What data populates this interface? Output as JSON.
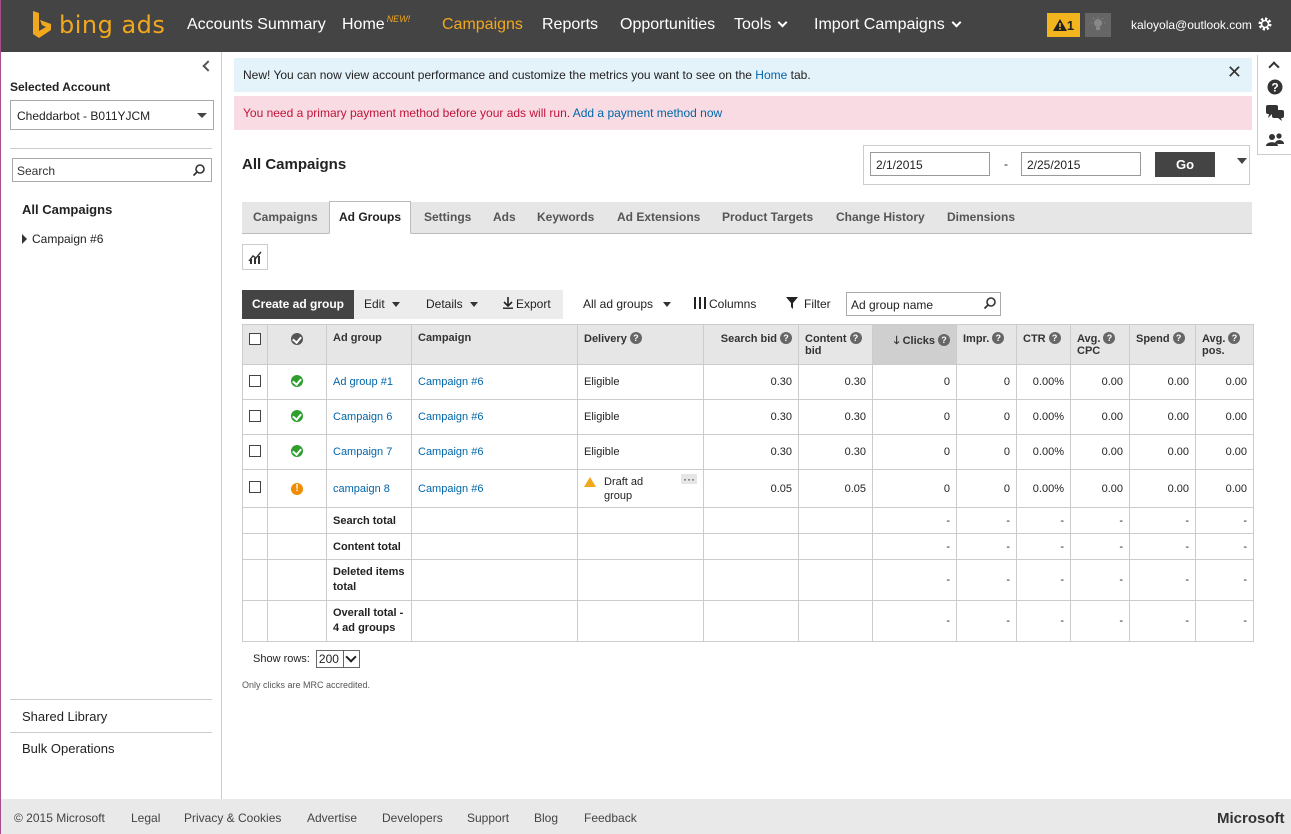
{
  "brand": {
    "name": "bing ads"
  },
  "topnav": {
    "items": [
      {
        "label": "Accounts Summary"
      },
      {
        "label": "Home",
        "badge": "NEW!"
      },
      {
        "label": "Campaigns"
      },
      {
        "label": "Reports"
      },
      {
        "label": "Opportunities"
      },
      {
        "label": "Tools"
      },
      {
        "label": "Import Campaigns"
      }
    ],
    "alert_count": "1",
    "user": "kaloyola@outlook.com"
  },
  "sidebar": {
    "selected_account_label": "Selected Account",
    "account": "Cheddarbot - B011YJCM",
    "search_placeholder": "Search",
    "all_campaigns": "All Campaigns",
    "campaign_node": "Campaign #6",
    "shared_library": "Shared Library",
    "bulk_operations": "Bulk Operations"
  },
  "banners": {
    "info_prefix": "New! You can now view account performance and customize the metrics you want to see on the ",
    "info_link": "Home",
    "info_suffix": " tab.",
    "error_text": "You need a primary payment method before your ads will run. ",
    "error_link": "Add a payment method now"
  },
  "main": {
    "title": "All Campaigns",
    "date_from": "2/1/2015",
    "date_sep": "-",
    "date_to": "2/25/2015",
    "go": "Go",
    "tabs": [
      "Campaigns",
      "Ad Groups",
      "Settings",
      "Ads",
      "Keywords",
      "Ad Extensions",
      "Product Targets",
      "Change History",
      "Dimensions"
    ],
    "active_tab": "Ad Groups"
  },
  "toolbar": {
    "create": "Create ad group",
    "edit": "Edit",
    "details": "Details",
    "export": "Export",
    "filter_select": "All ad groups",
    "columns": "Columns",
    "filter": "Filter",
    "search_placeholder": "Ad group name"
  },
  "grid": {
    "headers": {
      "ad_group": "Ad group",
      "campaign": "Campaign",
      "delivery": "Delivery",
      "search_bid": "Search bid",
      "content_bid_1": "Content",
      "content_bid_2": "bid",
      "clicks": "Clicks",
      "impr": "Impr.",
      "ctr": "CTR",
      "avg_cpc_1": "Avg.",
      "avg_cpc_2": "CPC",
      "spend": "Spend",
      "avg_pos_1": "Avg.",
      "avg_pos_2": "pos."
    },
    "rows": [
      {
        "status": "ok",
        "ad_group": "Ad group #1",
        "campaign": "Campaign #6",
        "delivery": "Eligible",
        "search_bid": "0.30",
        "content_bid": "0.30",
        "clicks": "0",
        "impr": "0",
        "ctr": "0.00%",
        "avg_cpc": "0.00",
        "spend": "0.00",
        "avg_pos": "0.00"
      },
      {
        "status": "ok",
        "ad_group": "Campaign 6",
        "campaign": "Campaign #6",
        "delivery": "Eligible",
        "search_bid": "0.30",
        "content_bid": "0.30",
        "clicks": "0",
        "impr": "0",
        "ctr": "0.00%",
        "avg_cpc": "0.00",
        "spend": "0.00",
        "avg_pos": "0.00"
      },
      {
        "status": "ok",
        "ad_group": "Campaign 7",
        "campaign": "Campaign #6",
        "delivery": "Eligible",
        "search_bid": "0.30",
        "content_bid": "0.30",
        "clicks": "0",
        "impr": "0",
        "ctr": "0.00%",
        "avg_cpc": "0.00",
        "spend": "0.00",
        "avg_pos": "0.00"
      },
      {
        "status": "alert",
        "ad_group": "campaign 8",
        "campaign": "Campaign #6",
        "delivery_1": "Draft ad",
        "delivery_2": "group",
        "search_bid": "0.05",
        "content_bid": "0.05",
        "clicks": "0",
        "impr": "0",
        "ctr": "0.00%",
        "avg_cpc": "0.00",
        "spend": "0.00",
        "avg_pos": "0.00"
      }
    ],
    "totals": [
      {
        "label": "Search total"
      },
      {
        "label": "Content total"
      },
      {
        "label_1": "Deleted items",
        "label_2": "total"
      },
      {
        "label_1": "Overall total -",
        "label_2": "4 ad groups"
      }
    ],
    "dash": "-"
  },
  "paging": {
    "label": "Show rows:",
    "value": "200"
  },
  "note": "Only clicks are MRC accredited.",
  "footer": {
    "copyright": "© 2015 Microsoft",
    "links": [
      "Legal",
      "Privacy & Cookies",
      "Advertise",
      "Developers",
      "Support",
      "Blog",
      "Feedback"
    ],
    "brand": "Microsoft"
  },
  "colors": {
    "accent": "#f2a81d",
    "nav_bg": "#444444",
    "link": "#0066aa",
    "error": "#c0143c"
  }
}
